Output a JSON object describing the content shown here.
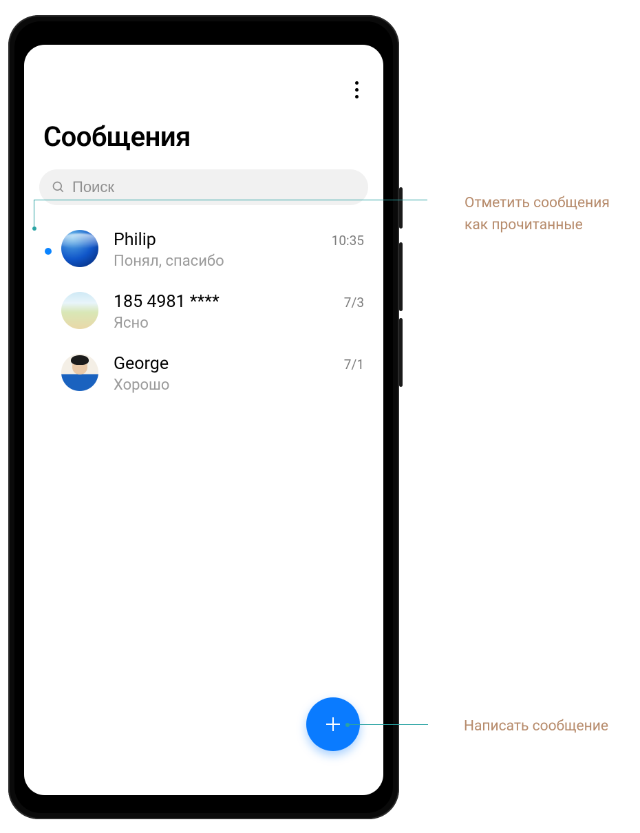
{
  "app": {
    "title": "Сообщения"
  },
  "search": {
    "placeholder": "Поиск"
  },
  "conversations": [
    {
      "name": "Philip",
      "preview": "Понял, спасибо",
      "time": "10:35",
      "unread": true,
      "avatar": "ocean"
    },
    {
      "name": "185 4981 ****",
      "preview": "Ясно",
      "time": "7/3",
      "unread": false,
      "avatar": "beach"
    },
    {
      "name": "George",
      "preview": "Хорошо",
      "time": "7/1",
      "unread": false,
      "avatar": "person"
    }
  ],
  "callouts": {
    "mark_read": "Отметить сообщения как прочитанные",
    "compose": "Написать сообщение"
  },
  "colors": {
    "accent": "#0a7bff",
    "callout_line": "#2aa3a3",
    "callout_text": "#b68a6a"
  }
}
